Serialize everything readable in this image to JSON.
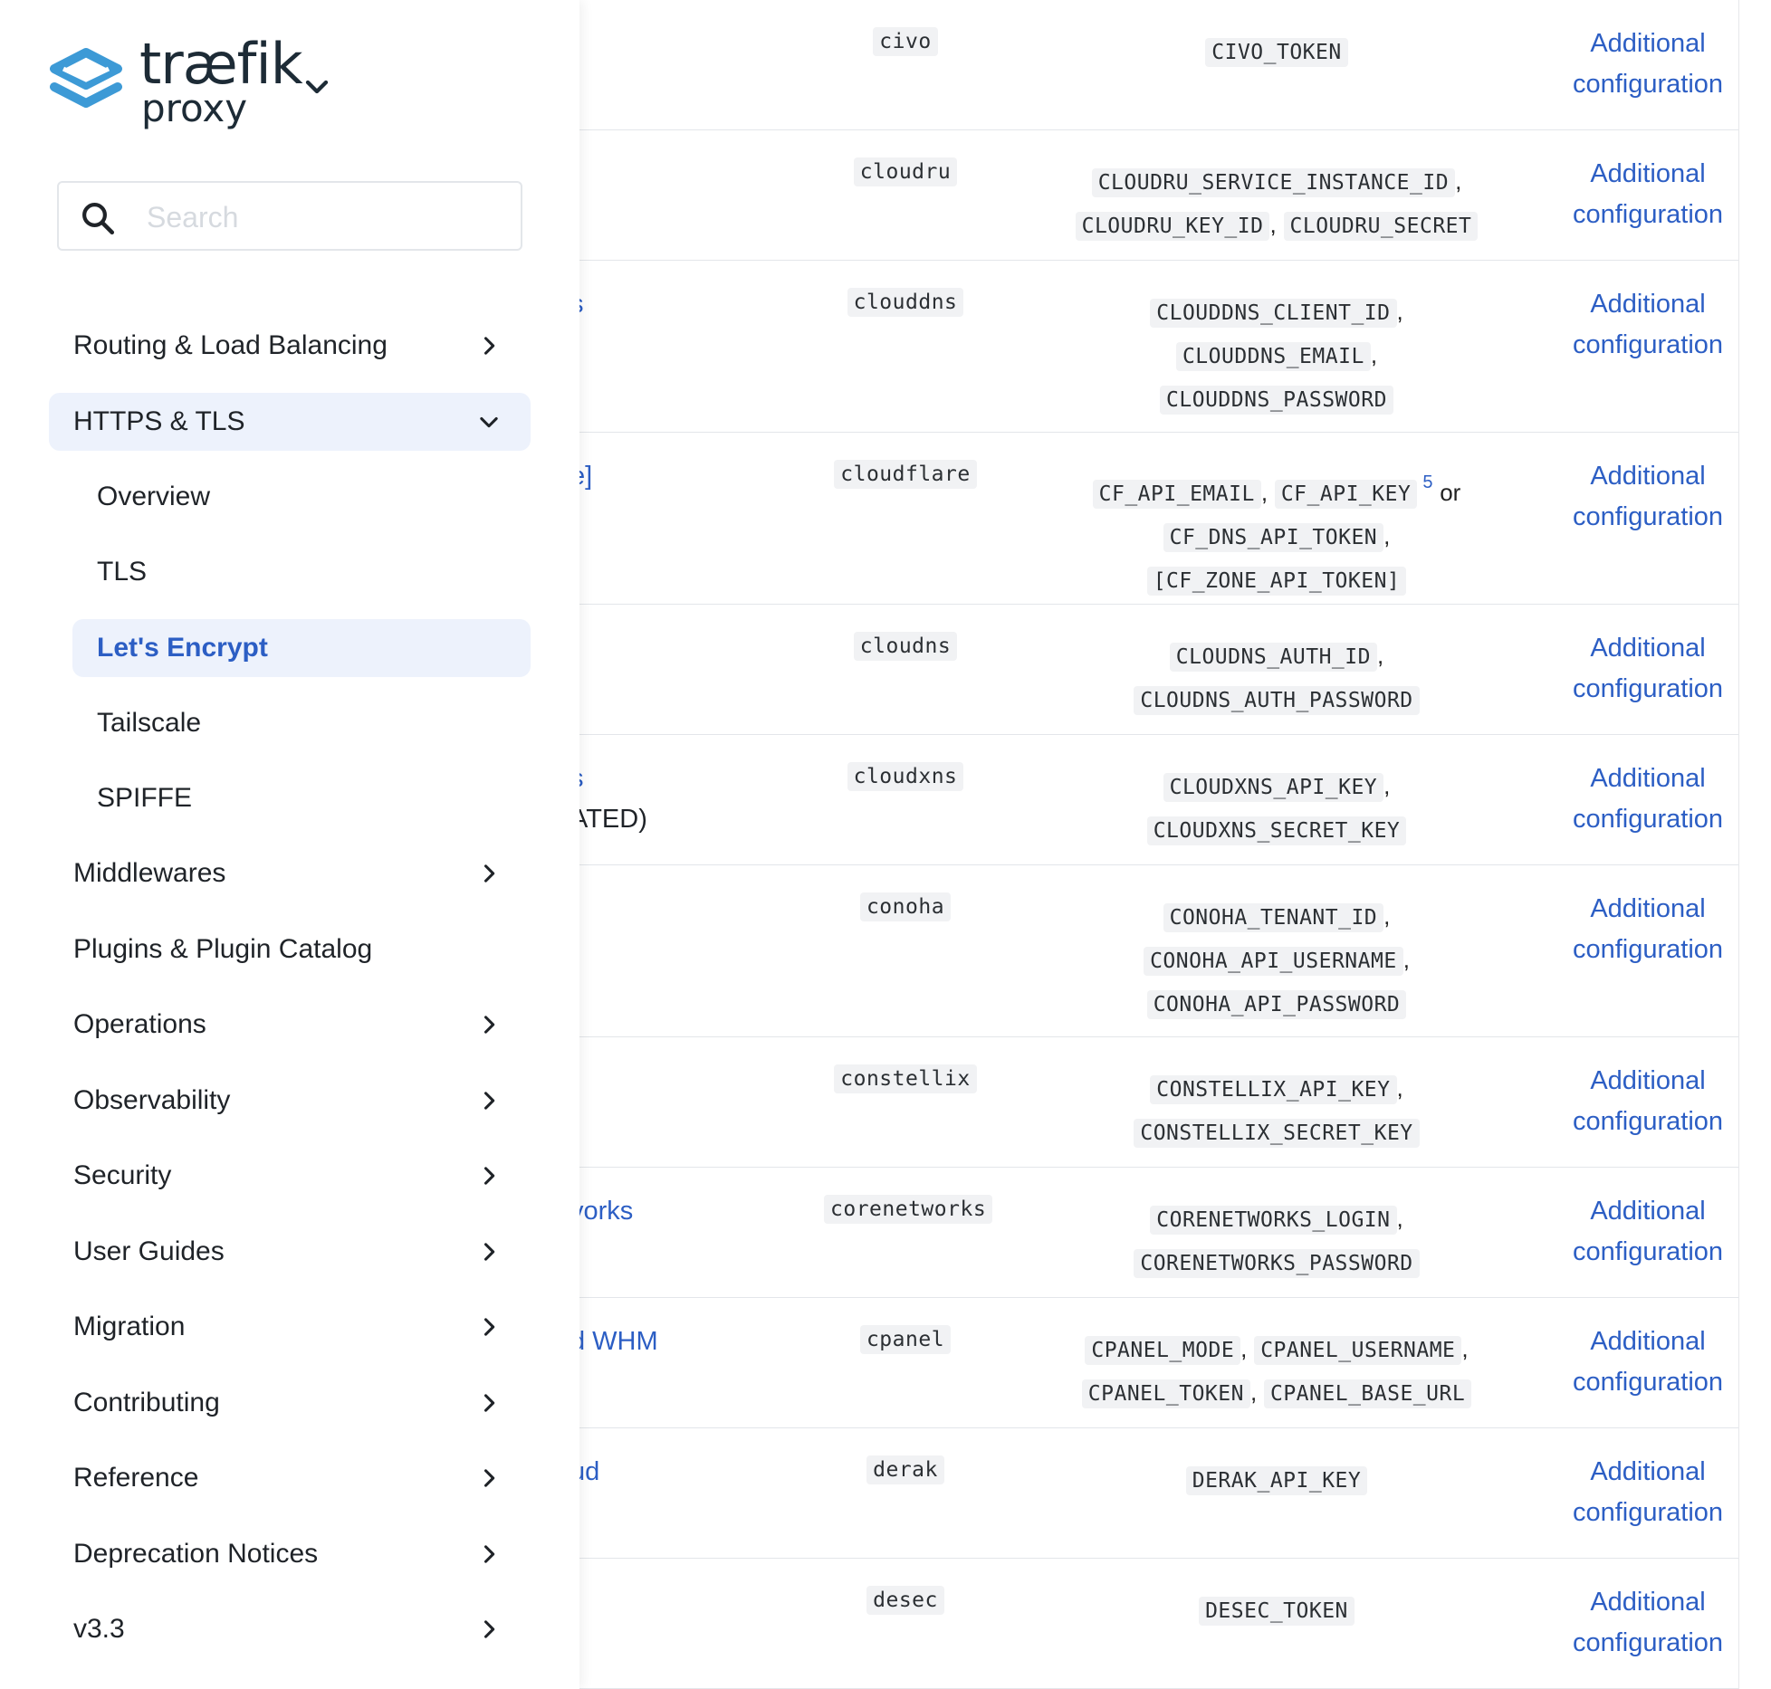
{
  "brand": {
    "name": "træfik",
    "sub": "proxy"
  },
  "search": {
    "placeholder": "Search"
  },
  "nav": {
    "routing": "Routing & Load Balancing",
    "https": "HTTPS & TLS",
    "overview": "Overview",
    "tls": "TLS",
    "letsencrypt": "Let's Encrypt",
    "tailscale": "Tailscale",
    "spiffe": "SPIFFE",
    "middlewares": "Middlewares",
    "plugins": "Plugins & Plugin Catalog",
    "operations": "Operations",
    "observability": "Observability",
    "security": "Security",
    "userguides": "User Guides",
    "migration": "Migration",
    "contributing": "Contributing",
    "reference": "Reference",
    "deprecation": "Deprecation Notices",
    "version": "v3.3"
  },
  "table": {
    "link_line1": "Additional",
    "link_line2": "configuration",
    "sep": ",",
    "or": "or",
    "footnote": "5",
    "rows": [
      {
        "name": "",
        "code": "civo",
        "env": [
          "CIVO_TOKEN"
        ]
      },
      {
        "name": "",
        "code": "cloudru",
        "env": [
          "CLOUDRU_SERVICE_INSTANCE_ID",
          "CLOUDRU_KEY_ID",
          "CLOUDRU_SECRET"
        ]
      },
      {
        "name": "s",
        "code": "clouddns",
        "env": [
          "CLOUDDNS_CLIENT_ID",
          "CLOUDDNS_EMAIL",
          "CLOUDDNS_PASSWORD"
        ]
      },
      {
        "name": "e]",
        "code": "cloudflare",
        "env": [
          "CF_API_EMAIL",
          "CF_API_KEY",
          "CF_DNS_API_TOKEN",
          "[CF_ZONE_API_TOKEN]"
        ]
      },
      {
        "name": "",
        "code": "cloudns",
        "env": [
          "CLOUDNS_AUTH_ID",
          "CLOUDNS_AUTH_PASSWORD"
        ]
      },
      {
        "name": "s",
        "name2": "ATED)",
        "code": "cloudxns",
        "env": [
          "CLOUDXNS_API_KEY",
          "CLOUDXNS_SECRET_KEY"
        ]
      },
      {
        "name": "",
        "code": "conoha",
        "env": [
          "CONOHA_TENANT_ID",
          "CONOHA_API_USERNAME",
          "CONOHA_API_PASSWORD"
        ]
      },
      {
        "name": "",
        "code": "constellix",
        "env": [
          "CONSTELLIX_API_KEY",
          "CONSTELLIX_SECRET_KEY"
        ]
      },
      {
        "name": "vorks",
        "code": "corenetworks",
        "env": [
          "CORENETWORKS_LOGIN",
          "CORENETWORKS_PASSWORD"
        ]
      },
      {
        "name": "d WHM",
        "code": "cpanel",
        "env": [
          "CPANEL_MODE",
          "CPANEL_USERNAME",
          "CPANEL_TOKEN",
          "CPANEL_BASE_URL"
        ]
      },
      {
        "name": "ud",
        "code": "derak",
        "env": [
          "DERAK_API_KEY"
        ]
      },
      {
        "name": "",
        "code": "desec",
        "env": [
          "DESEC_TOKEN"
        ]
      }
    ]
  },
  "colors": {
    "accent": "#2c5ec4",
    "active_bg": "#edf2fc",
    "logo_blue": "#3d9ad6"
  }
}
